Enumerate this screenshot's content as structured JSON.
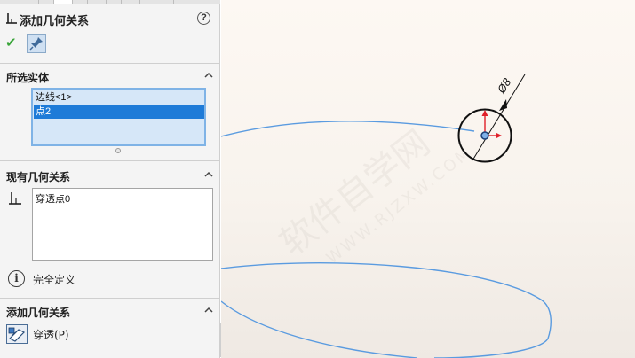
{
  "panel": {
    "title": "添加几何关系",
    "help_glyph": "?",
    "ok_glyph": "✔"
  },
  "selected_entities": {
    "header": "所选实体",
    "items": [
      {
        "label": "边线<1>",
        "selected": false
      },
      {
        "label": "点2",
        "selected": true
      }
    ]
  },
  "existing_relations": {
    "header": "现有几何关系",
    "items": [
      "穿透点0"
    ],
    "status_glyph": "i",
    "status_text": "完全定义"
  },
  "add_relations": {
    "header": "添加几何关系",
    "pierce_label": "穿透(P)"
  },
  "canvas": {
    "dimension_text": "Ø8",
    "watermark_main": "软件自学网",
    "watermark_sub": "WWW.RJZXW.COM"
  },
  "colors": {
    "accent": "#1e7bd8",
    "curve": "#5a9be0",
    "axis_red": "#e0202a",
    "ok_green": "#3aa53a"
  }
}
